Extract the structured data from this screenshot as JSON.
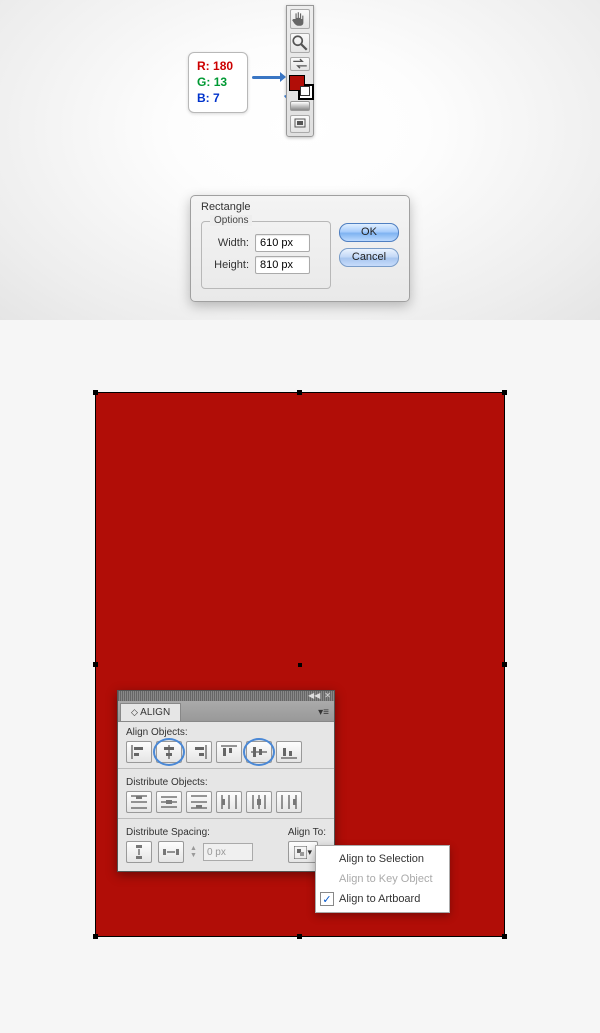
{
  "rgb": {
    "r_label": "R:",
    "r_val": "180",
    "g_label": "G:",
    "g_val": "13",
    "b_label": "B:",
    "b_val": "7"
  },
  "dialog": {
    "title": "Rectangle",
    "options_legend": "Options",
    "width_label": "Width:",
    "width_value": "610 px",
    "height_label": "Height:",
    "height_value": "810 px",
    "ok": "OK",
    "cancel": "Cancel"
  },
  "align": {
    "tab": "ALIGN",
    "align_objects": "Align Objects:",
    "distribute_objects": "Distribute Objects:",
    "distribute_spacing": "Distribute Spacing:",
    "align_to": "Align To:",
    "spacing_value": "0 px"
  },
  "flyout": {
    "opt1": "Align to Selection",
    "opt2": "Align to Key Object",
    "opt3": "Align to Artboard",
    "check": "✓"
  },
  "tools": {
    "hand": "hand",
    "zoom": "zoom",
    "fillstroke": "fill-stroke",
    "grad": "gradient",
    "screen": "screen-mode"
  },
  "colors": {
    "rect_fill": "#b10d07"
  }
}
